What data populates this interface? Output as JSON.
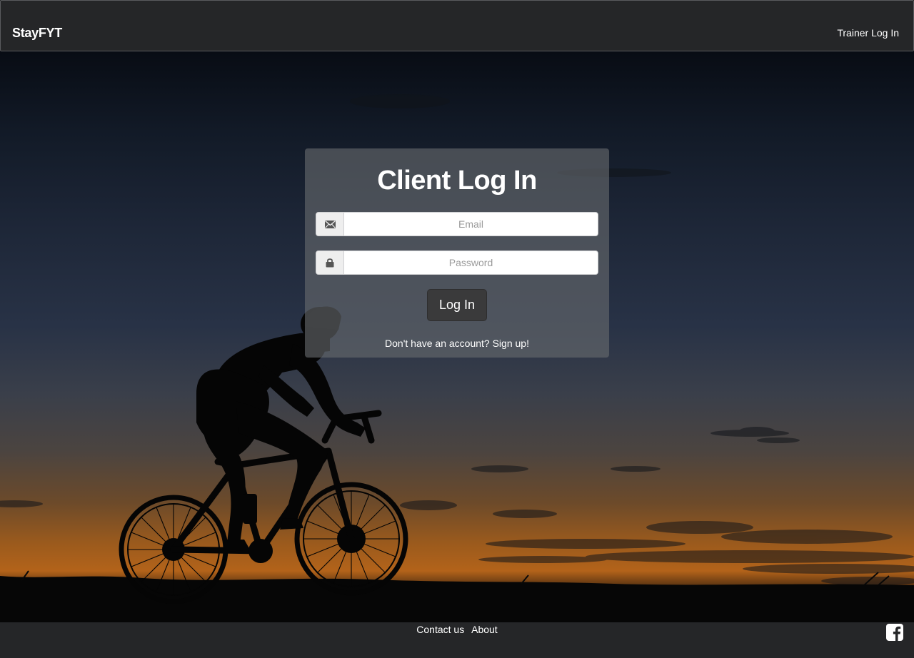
{
  "navbar": {
    "brand": "StayFYT",
    "trainer_login": "Trainer Log In"
  },
  "login": {
    "title": "Client Log In",
    "email_placeholder": "Email",
    "password_placeholder": "Password",
    "submit_label": "Log In",
    "signup_text": "Don't have an account? Sign up!"
  },
  "footer": {
    "links": [
      "Contact us",
      "About"
    ],
    "social_icon": "facebook-icon"
  },
  "icons": {
    "email": "envelope-icon",
    "password": "lock-icon"
  },
  "colors": {
    "navbar_bg": "#252628",
    "button_bg": "#3a3a3b",
    "text": "#ffffff"
  }
}
